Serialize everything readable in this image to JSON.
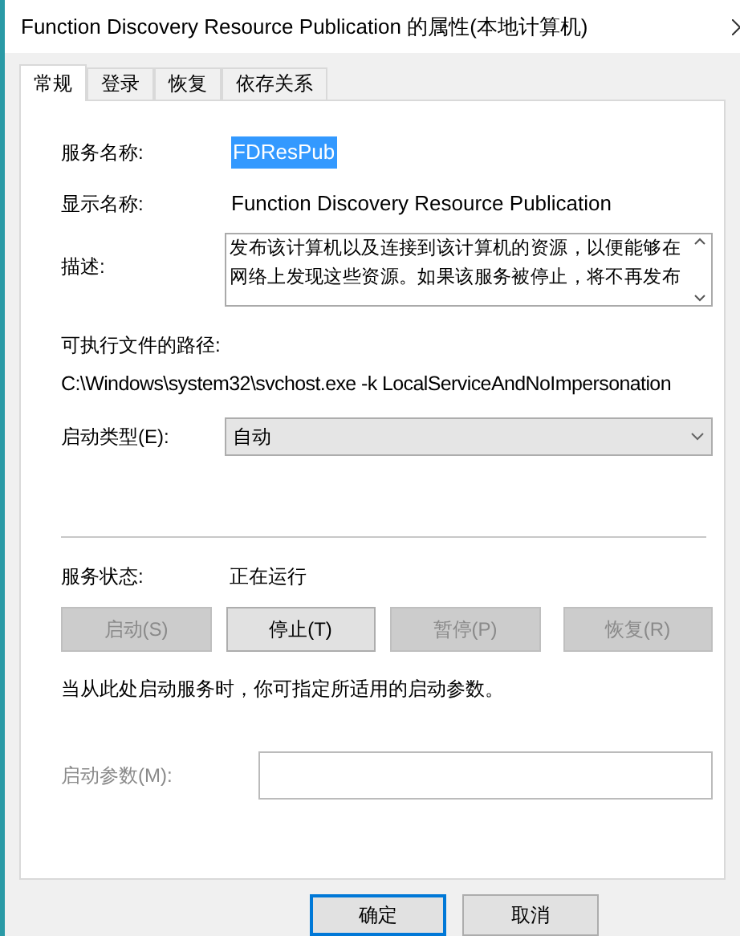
{
  "window": {
    "title": "Function Discovery Resource Publication 的属性(本地计算机)"
  },
  "tabs": [
    {
      "label": "常规",
      "selected": true
    },
    {
      "label": "登录",
      "selected": false
    },
    {
      "label": "恢复",
      "selected": false
    },
    {
      "label": "依存关系",
      "selected": false
    }
  ],
  "service_name": {
    "label": "服务名称:",
    "value": "FDResPub",
    "selected": true
  },
  "display_name": {
    "label": "显示名称:",
    "value": "Function Discovery Resource Publication"
  },
  "description": {
    "label": "描述:",
    "value": "发布该计算机以及连接到该计算机的资源，以便能够在网络上发现这些资源。如果该服务被停止，将不再发布"
  },
  "executable_path": {
    "label": "可执行文件的路径:",
    "value": "C:\\Windows\\system32\\svchost.exe -k LocalServiceAndNoImpersonation"
  },
  "startup_type": {
    "label": "启动类型(E):",
    "value": "自动"
  },
  "service_status": {
    "label": "服务状态:",
    "value": "正在运行"
  },
  "service_buttons": [
    {
      "label": "启动(S)",
      "disabled": true
    },
    {
      "label": "停止(T)",
      "disabled": false
    },
    {
      "label": "暂停(P)",
      "disabled": true
    },
    {
      "label": "恢复(R)",
      "disabled": true
    }
  ],
  "hint": "当从此处启动服务时，你可指定所适用的启动参数。",
  "start_parameters": {
    "label": "启动参数(M):",
    "disabled": true
  },
  "dialog_buttons": [
    {
      "label": "确定",
      "default": true
    },
    {
      "label": "取消",
      "default": false
    }
  ]
}
